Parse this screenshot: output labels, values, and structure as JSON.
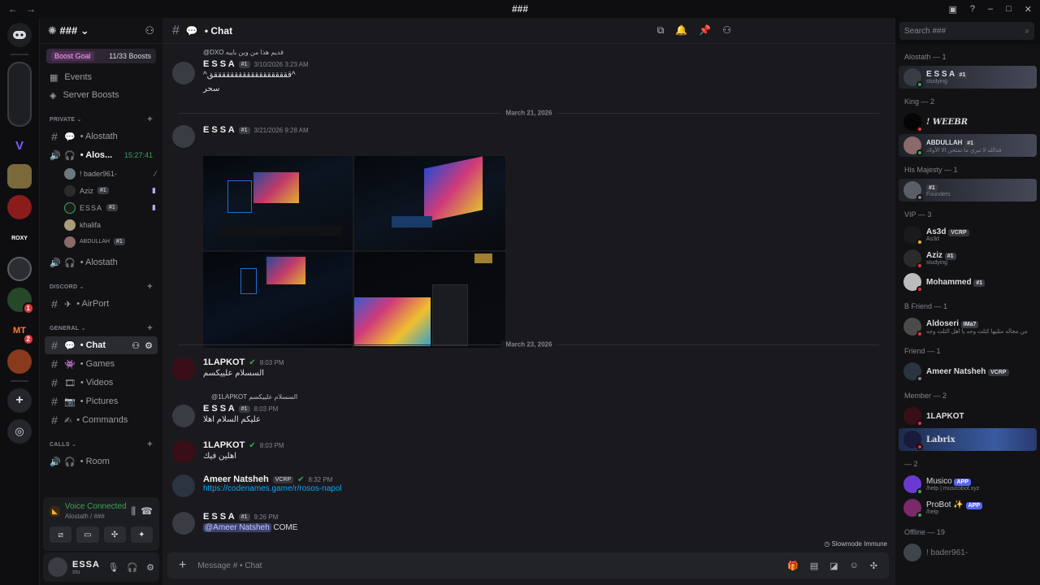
{
  "window": {
    "title": "###"
  },
  "server": {
    "name": "###",
    "boost_goal_label": "Boost Goal",
    "boost_count": "11/33 Boosts",
    "nav": [
      {
        "label": "Events",
        "icon": "calendar-icon"
      },
      {
        "label": "Server Boosts",
        "icon": "boost-icon"
      }
    ],
    "categories": {
      "private": "PRIVATE",
      "discord": "DISCORD",
      "general": "GENERAL",
      "calls": "CALLS"
    },
    "private_channels": [
      {
        "label": "• Alostath",
        "type": "text"
      },
      {
        "label": "• Alos...",
        "type": "voice",
        "time": "15:27:41"
      }
    ],
    "voice_users": [
      {
        "name": "! bader961-",
        "tag": ""
      },
      {
        "name": "Aziz",
        "tag": "#1"
      },
      {
        "name": "ESSA",
        "tag": "#1"
      },
      {
        "name": "khalifa",
        "tag": ""
      },
      {
        "name": "ABDULLAH",
        "tag": "#1"
      }
    ],
    "voice_channel_2": "• Alostath",
    "discord_channels": [
      {
        "label": "• AirPort"
      }
    ],
    "general_channels": [
      {
        "label": "• Chat",
        "active": true
      },
      {
        "label": "• Games"
      },
      {
        "label": "• Videos"
      },
      {
        "label": "• Pictures"
      },
      {
        "label": "• Commands"
      }
    ],
    "calls_channels": [
      {
        "label": "• Room"
      }
    ]
  },
  "voice_panel": {
    "title": "Voice Connected",
    "subtitle": "Alostath / ###"
  },
  "user_panel": {
    "name": "ESSA",
    "status": "stu"
  },
  "channel": {
    "name": "• Chat",
    "composer_placeholder": "Message # • Chat",
    "slowmode": "Slowmode Immune"
  },
  "search": {
    "placeholder": "Search ###"
  },
  "messages": {
    "reply1": "@DXO قديم هذا من وين بايبه",
    "m1_author": "E S S A",
    "m1_tag": "#1",
    "m1_time": "3/10/2026 3:23 AM",
    "m1_line1": "^قققققققققققققققققققق^",
    "m1_line2": "سحر",
    "sep1": "March 21, 2026",
    "m2_author": "E S S A",
    "m2_tag": "#1",
    "m2_time": "3/21/2026 9:28 AM",
    "sep2": "March 23, 2026",
    "m3_author": "1LAPKOT",
    "m3_time": "8:03 PM",
    "m3_text": "السسلام علييكسم",
    "reply2": "@1LAPKOT السسلام علييكسم",
    "m4_author": "E S S A",
    "m4_tag": "#1",
    "m4_time": "8:03 PM",
    "m4_text": "عليكم السلام اهلا",
    "m5_author": "1LAPKOT",
    "m5_time": "8:03 PM",
    "m5_text": "اهلين فيك",
    "m6_author": "Ameer Natsheh",
    "m6_tag": "VCRP",
    "m6_time": "8:32 PM",
    "m6_link": "https://codenames.game/r/rosos-napol",
    "m7_author": "E S S A",
    "m7_tag": "#1",
    "m7_time": "9:26 PM",
    "m7_mention": "@Ameer Natsheh",
    "m7_text": " COME"
  },
  "members": {
    "g1": "Alostath — 1",
    "g1_m1_name": "E S S A",
    "g1_m1_tag": "#1",
    "g1_m1_sub": "studying",
    "g2": "King — 2",
    "g2_m1_name": "! WEEBR",
    "g2_m2_name": "ABDULLAH",
    "g2_m2_tag": "#1",
    "g2_m2_sub": "فدالله لا تبري ما تمتحن الا الأولاد",
    "g3": "His Majesty — 1",
    "g3_m1_tag": "#1",
    "g3_m1_sub": "Founders",
    "g4": "VIP — 3",
    "g4_m1_name": "As3d",
    "g4_m1_tag": "VCRP",
    "g4_m1_sub": "As3d",
    "g4_m2_name": "Aziz",
    "g4_m2_tag": "#1",
    "g4_m2_sub": "studying",
    "g4_m3_name": "Mohammed",
    "g4_m3_tag": "#1",
    "g5": "B Friend — 1",
    "g5_m1_name": "Aldoseri",
    "g5_m1_tag": "IMa7",
    "g5_m1_sub": "من مجاله مثليها كثلث وجه يا اهل الثلث وجه",
    "g6": "Friend — 1",
    "g6_m1_name": "Ameer Natsheh",
    "g6_m1_tag": "VCRP",
    "g7": "Member — 2",
    "g7_m1_name": "1LAPKOT",
    "g7_m2_name": "Labrix",
    "g8": "— 2",
    "g8_m1_name": "Musico",
    "g8_m1_tag": "APP",
    "g8_m1_sub": "/help | musicobot.xyz",
    "g8_m2_name": "ProBot ✨",
    "g8_m2_tag": "APP",
    "g8_m2_sub": "/help",
    "g9": "Offline — 19",
    "g9_m1_name": "! bader961-"
  },
  "colors": {
    "accent": "#5865f2",
    "online": "#3ba55c",
    "dnd": "#da373c",
    "link": "#00a8fc"
  }
}
